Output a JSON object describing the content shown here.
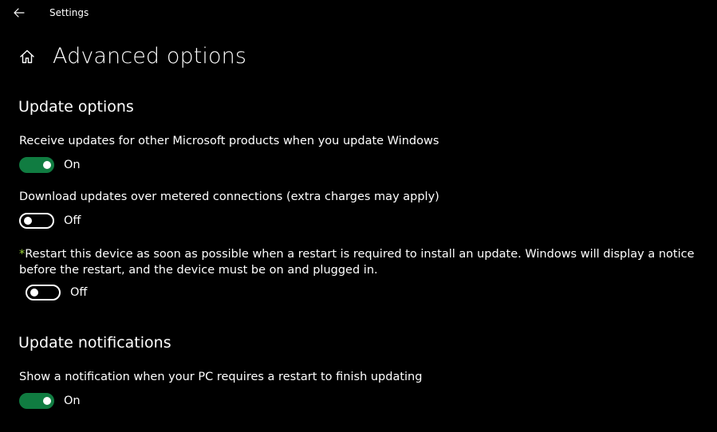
{
  "window": {
    "app_title": "Settings",
    "back_icon": "arrow-left-icon"
  },
  "header": {
    "home_icon": "home-icon",
    "page_title": "Advanced options"
  },
  "update_options": {
    "section_title": "Update options",
    "other_products": {
      "label": "Receive updates for other Microsoft products when you update Windows",
      "state": "On",
      "is_on": true
    },
    "metered": {
      "label": "Download updates over metered connections (extra charges may apply)",
      "state": "Off",
      "is_on": false
    },
    "restart": {
      "marker": "*",
      "label": "Restart this device as soon as possible when a restart is required to install an update. Windows will display a notice before the restart, and the device must be on and plugged in.",
      "state": "Off",
      "is_on": false
    }
  },
  "update_notifications": {
    "section_title": "Update notifications",
    "restart_notification": {
      "label": "Show a notification when your PC requires a restart to finish updating",
      "state": "On",
      "is_on": true
    }
  },
  "colors": {
    "background": "#000000",
    "text": "#ffffff",
    "toggle_on": "#107c41",
    "asterisk": "#9bd33a"
  }
}
